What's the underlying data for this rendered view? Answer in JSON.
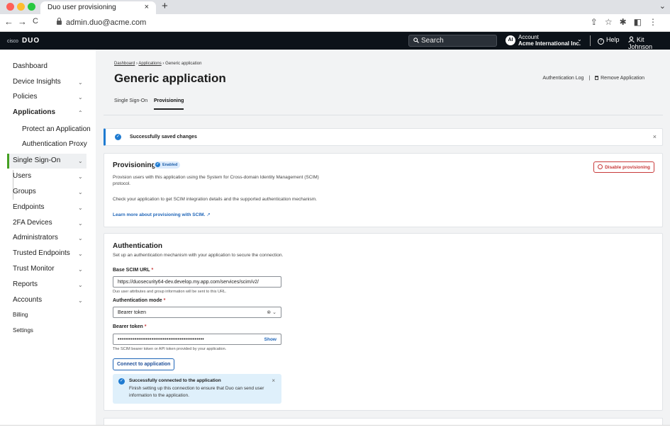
{
  "browser": {
    "tab_title": "Duo user provisioning",
    "tab_close": "×",
    "new_tab": "+",
    "tab_menu": "⌄",
    "url": "admin.duo@acme.com",
    "nav": {
      "back": "←",
      "forward": "→",
      "reload": "C"
    },
    "icons": "⇪☆✱◧⋮",
    "dots": [
      "#ff5f57",
      "#febc2e",
      "#28c840"
    ]
  },
  "topnav": {
    "brand_small": "cisco",
    "brand": "DUO",
    "search_placeholder": "Search",
    "account_initials": "AI",
    "account_label": "Account",
    "account_name": "Acme International Inc.",
    "help": "Help",
    "user": "Kit Johnson"
  },
  "sidebar": {
    "items": [
      {
        "label": "Dashboard",
        "chevron": ""
      },
      {
        "label": "Device Insights",
        "chevron": "⌄"
      },
      {
        "label": "Policies",
        "chevron": "⌄"
      },
      {
        "label": "Applications",
        "chevron": "⌃"
      },
      {
        "label": "Protect an Application",
        "chevron": ""
      },
      {
        "label": "Authentication Proxy",
        "chevron": ""
      },
      {
        "label": "Single Sign-On",
        "chevron": "⌄"
      },
      {
        "label": "Users",
        "chevron": "⌄"
      },
      {
        "label": "Groups",
        "chevron": "⌄"
      },
      {
        "label": "Endpoints",
        "chevron": "⌄"
      },
      {
        "label": "2FA Devices",
        "chevron": "⌄"
      },
      {
        "label": "Administrators",
        "chevron": "⌄"
      },
      {
        "label": "Trusted Endpoints",
        "chevron": "⌄"
      },
      {
        "label": "Trust Monitor",
        "chevron": "⌄"
      },
      {
        "label": "Reports",
        "chevron": "⌄"
      },
      {
        "label": "Accounts",
        "chevron": "⌄"
      },
      {
        "label": "Billing",
        "chevron": ""
      },
      {
        "label": "Settings",
        "chevron": ""
      }
    ]
  },
  "page": {
    "breadcrumb": [
      "Dashboard",
      "Applications",
      "Generic application"
    ],
    "crumb_sep": "›",
    "title": "Generic application",
    "auth_log": "Authentication Log",
    "remove_app": "Remove Application",
    "tabs": [
      "Single Sign-On",
      "Provisioning"
    ]
  },
  "toast": {
    "message": "Successfully saved changes",
    "close": "×"
  },
  "provisioning": {
    "title": "Provisioning",
    "status": "Enabled",
    "desc1": "Provision users with this application using the System for Cross-domain Identity Management (SCIM) protocol.",
    "desc2": "Check your application to get SCIM integration details and the supported authentication mechanism.",
    "learn_more": "Learn more about provisioning with SCIM.",
    "disable": "Disable provisioning"
  },
  "authentication": {
    "title": "Authentication",
    "desc": "Set up an authentication mechanism with your application to secure the connection.",
    "base_url_label": "Base SCIM URL",
    "base_url_value": "https://duosecurity64-dev.develop.my.app.com/services/scim/v2/",
    "base_url_help": "Duo user attributes and group information will be sent to this URL.",
    "mode_label": "Authentication mode",
    "mode_value": "Bearer token",
    "token_label": "Bearer token",
    "token_value": "••••••••••••••••••••••••••••••••••••••••••••••",
    "token_show": "Show",
    "token_help": "The SCIM bearer token or API token provided by your application.",
    "connect_button": "Connect to application",
    "required_marker": "*",
    "success_title": "Successfully connected to the application",
    "success_msg": "Finish setting up this connection to ensure that Duo can send user information to the application.",
    "success_close": "×"
  },
  "colors": {
    "accent_green": "#45a023",
    "link_blue": "#1f65b8",
    "danger_red": "#c83a3a",
    "nav_bg": "#0c1219"
  }
}
